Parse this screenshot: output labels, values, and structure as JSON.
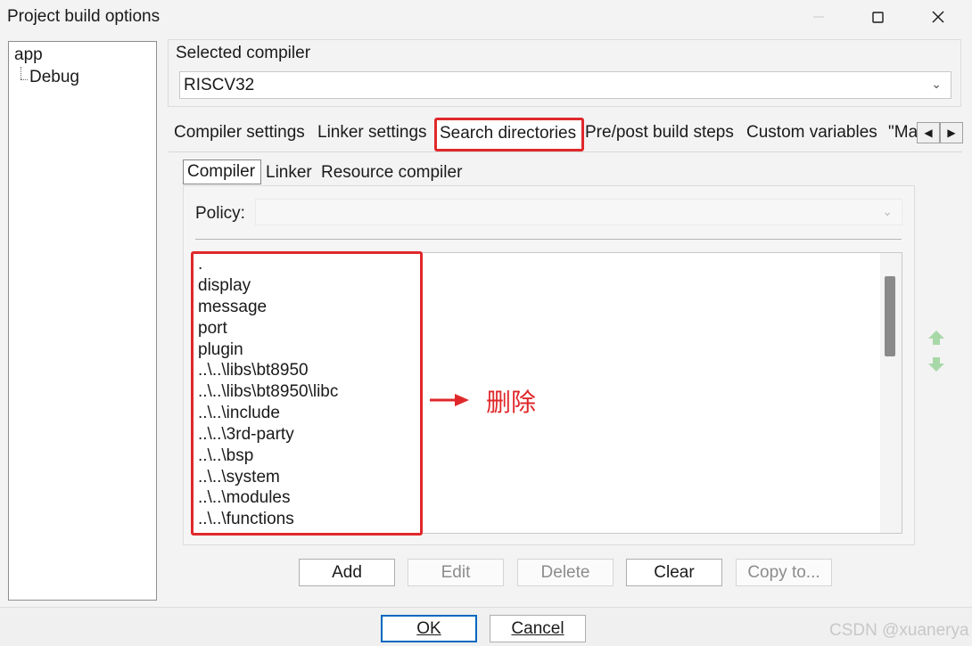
{
  "window": {
    "title": "Project build options"
  },
  "tree": {
    "root": "app",
    "child": "Debug"
  },
  "compiler": {
    "group_label": "Selected compiler",
    "selected": "RISCV32"
  },
  "tabs": [
    {
      "label": "Compiler settings"
    },
    {
      "label": "Linker settings"
    },
    {
      "label": "Search directories",
      "active": true
    },
    {
      "label": "Pre/post build steps"
    },
    {
      "label": "Custom variables"
    },
    {
      "label": "\"Ma"
    }
  ],
  "subtabs": [
    {
      "label": "Compiler",
      "active": true
    },
    {
      "label": "Linker"
    },
    {
      "label": "Resource compiler"
    }
  ],
  "policy": {
    "label": "Policy:",
    "value": ""
  },
  "directories": [
    ".",
    "display",
    "message",
    "port",
    "plugin",
    "..\\..\\libs\\bt8950",
    "..\\..\\libs\\bt8950\\libc",
    "..\\..\\include",
    "..\\..\\3rd-party",
    "..\\..\\bsp",
    "..\\..\\system",
    "..\\..\\modules",
    "..\\..\\functions"
  ],
  "annotation": {
    "text": "删除",
    "color": "#e0282b"
  },
  "buttons": {
    "add": "Add",
    "edit": "Edit",
    "delete": "Delete",
    "clear": "Clear",
    "copy_to": "Copy to..."
  },
  "footer": {
    "ok": "OK",
    "cancel": "Cancel"
  },
  "watermark": "CSDN @xuanerya",
  "icons": {
    "minimize": "minimize-icon",
    "maximize": "maximize-icon",
    "close": "close-icon",
    "scroll_left": "chevron-left-icon",
    "scroll_right": "chevron-right-icon",
    "move_up": "arrow-up-icon",
    "move_down": "arrow-down-icon"
  }
}
